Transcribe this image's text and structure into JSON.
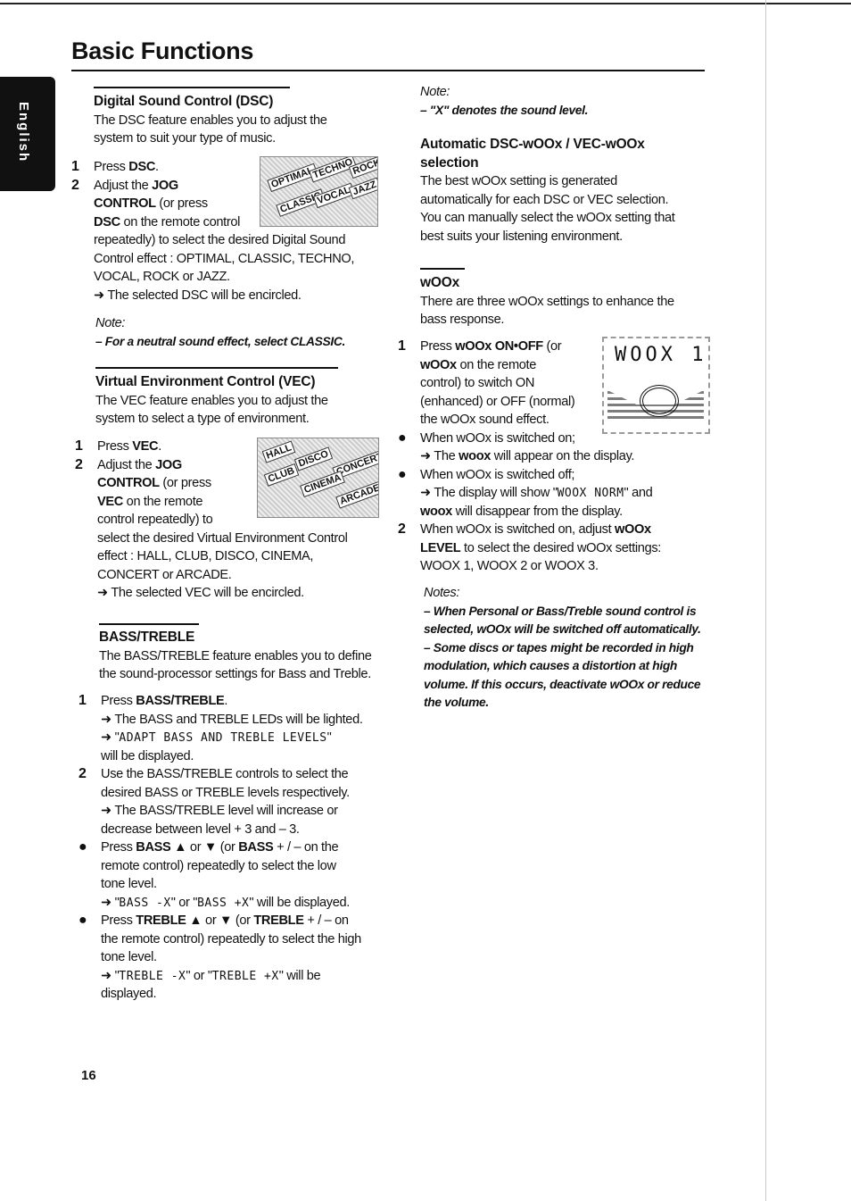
{
  "header": {
    "title": "Basic Functions",
    "language_tab": "English",
    "page_number": "16"
  },
  "images": {
    "dsc_display": [
      "OPTIMAL",
      "TECHNO",
      "ROCK",
      "CLASSIC",
      "VOCAL",
      "JAZZ"
    ],
    "vec_display": [
      "HALL",
      "DISCO",
      "CONCERT",
      "CLUB",
      "CINEMA",
      "ARCADE"
    ],
    "woox_display": "WOOX 1"
  },
  "left": [
    {
      "lines": [
        {
          "h": 1,
          "s": [
            [
              "Digital Sound Control (DSC)",
              0
            ]
          ]
        },
        {
          "s": [
            [
              "The DSC feature enables you to adjust the",
              0
            ]
          ]
        },
        {
          "s": [
            [
              "system to suit your type of music.",
              0
            ]
          ]
        }
      ]
    },
    {
      "lines": [
        {
          "m": "1",
          "s": [
            [
              "Press ",
              0
            ],
            [
              "DSC",
              1
            ],
            [
              ".",
              0
            ]
          ]
        },
        {
          "m": "2",
          "s": [
            [
              "Adjust the ",
              0
            ],
            [
              "JOG",
              1
            ]
          ]
        },
        {
          "s": [
            [
              "CONTROL",
              1
            ],
            [
              " (or press",
              0
            ]
          ]
        },
        {
          "s": [
            [
              "DSC",
              1
            ],
            [
              " on the remote control",
              0
            ]
          ]
        },
        {
          "s": [
            [
              "repeatedly) to select the desired Digital Sound",
              0
            ]
          ]
        },
        {
          "s": [
            [
              "Control effect : OPTIMAL, CLASSIC, TECHNO,",
              0
            ]
          ]
        },
        {
          "s": [
            [
              "VOCAL, ROCK or JAZZ.",
              0
            ]
          ]
        },
        {
          "s": [
            [
              "➜ The selected DSC will be encircled.",
              0
            ]
          ]
        }
      ]
    },
    {
      "lines": [
        {
          "s": [
            [
              "Note:",
              2
            ]
          ]
        },
        {
          "s": [
            [
              "– For a neutral sound effect, select CLASSIC.",
              4
            ]
          ]
        }
      ]
    },
    {
      "lines": [
        {
          "h": 1,
          "s": [
            [
              "Virtual Environment Control (VEC)",
              0
            ]
          ]
        },
        {
          "s": [
            [
              "The VEC feature enables you to adjust the",
              0
            ]
          ]
        },
        {
          "s": [
            [
              "system to select a type of environment.",
              0
            ]
          ]
        }
      ]
    },
    {
      "lines": [
        {
          "m": "1",
          "s": [
            [
              "Press ",
              0
            ],
            [
              "VEC",
              1
            ],
            [
              ".",
              0
            ]
          ]
        },
        {
          "m": "2",
          "s": [
            [
              "Adjust the ",
              0
            ],
            [
              "JOG",
              1
            ]
          ]
        },
        {
          "s": [
            [
              "CONTROL",
              1
            ],
            [
              " (or press",
              0
            ]
          ]
        },
        {
          "s": [
            [
              "VEC",
              1
            ],
            [
              " on the remote",
              0
            ]
          ]
        },
        {
          "s": [
            [
              "control repeatedly) to",
              0
            ]
          ]
        },
        {
          "s": [
            [
              "select the desired Virtual Environment Control",
              0
            ]
          ]
        },
        {
          "s": [
            [
              "effect : HALL, CLUB, DISCO, CINEMA,",
              0
            ]
          ]
        },
        {
          "s": [
            [
              "CONCERT or ARCADE.",
              0
            ]
          ]
        },
        {
          "s": [
            [
              "➜ The selected VEC will be encircled.",
              0
            ]
          ]
        }
      ]
    },
    {
      "lines": [
        {
          "h": 1,
          "s": [
            [
              "BASS/TREBLE",
              0
            ]
          ]
        },
        {
          "s": [
            [
              "The BASS/TREBLE feature enables you to define",
              0
            ]
          ]
        },
        {
          "s": [
            [
              "the sound-processor settings for Bass and Treble.",
              0
            ]
          ]
        }
      ]
    },
    {
      "lines": [
        {
          "m": "1",
          "s": [
            [
              "Press ",
              0
            ],
            [
              "BASS/TREBLE",
              1
            ],
            [
              ".",
              0
            ]
          ]
        },
        {
          "s": [
            [
              "➜ The BASS and TREBLE LEDs will be lighted.",
              0
            ]
          ]
        },
        {
          "s": [
            [
              "➜ \"",
              0
            ],
            [
              "ADAPT BASS AND TREBLE LEVELS",
              3
            ],
            [
              "\"",
              0
            ]
          ]
        },
        {
          "s": [
            [
              "will be displayed.",
              0
            ]
          ]
        },
        {
          "m": "2",
          "s": [
            [
              "Use the  BASS/TREBLE controls to select the",
              0
            ]
          ]
        },
        {
          "s": [
            [
              "desired BASS or TREBLE levels respectively.",
              0
            ]
          ]
        },
        {
          "s": [
            [
              "➜ The BASS/TREBLE level will increase or",
              0
            ]
          ]
        },
        {
          "s": [
            [
              "decrease between level + 3 and – 3.",
              0
            ]
          ]
        },
        {
          "m": "●",
          "s": [
            [
              "Press ",
              0
            ],
            [
              "BASS",
              1
            ],
            [
              " ▲ or ▼ (or ",
              0
            ],
            [
              "BASS",
              1
            ],
            [
              " + / – on the",
              0
            ]
          ]
        },
        {
          "s": [
            [
              "remote control) repeatedly to select the low",
              0
            ]
          ]
        },
        {
          "s": [
            [
              "tone level.",
              0
            ]
          ]
        },
        {
          "s": [
            [
              "➜ \"",
              0
            ],
            [
              "BASS -X",
              3
            ],
            [
              "\" or \"",
              0
            ],
            [
              "BASS +X",
              3
            ],
            [
              "\"  will be displayed.",
              0
            ]
          ]
        },
        {
          "m": "●",
          "s": [
            [
              "Press ",
              0
            ],
            [
              "TREBLE",
              1
            ],
            [
              " ▲ or ▼ (or ",
              0
            ],
            [
              "TREBLE",
              1
            ],
            [
              " + / – on",
              0
            ]
          ]
        },
        {
          "s": [
            [
              "the remote control) repeatedly to select the high",
              0
            ]
          ]
        },
        {
          "s": [
            [
              "tone level.",
              0
            ]
          ]
        },
        {
          "s": [
            [
              "➜ \"",
              0
            ],
            [
              "TREBLE -X",
              3
            ],
            [
              "\" or \"",
              0
            ],
            [
              "TREBLE +X",
              3
            ],
            [
              "\"  will be",
              0
            ]
          ]
        },
        {
          "s": [
            [
              "displayed.",
              0
            ]
          ]
        }
      ]
    }
  ],
  "right": [
    {
      "lines": [
        {
          "s": [
            [
              "Note:",
              2
            ]
          ]
        },
        {
          "s": [
            [
              "– \"X\" denotes the sound level.",
              4
            ]
          ]
        }
      ]
    },
    {
      "lines": [
        {
          "h": 1,
          "s": [
            [
              "Automatic DSC-wOOx / VEC-wOOx",
              0
            ]
          ]
        },
        {
          "h": 1,
          "s": [
            [
              "selection",
              0
            ]
          ]
        },
        {
          "s": [
            [
              "The best wOOx setting is generated",
              0
            ]
          ]
        },
        {
          "s": [
            [
              "automatically for each DSC or VEC selection.",
              0
            ]
          ]
        },
        {
          "s": [
            [
              "You can manually select the wOOx setting that",
              0
            ]
          ]
        },
        {
          "s": [
            [
              "best suits your listening environment.",
              0
            ]
          ]
        }
      ]
    },
    {
      "lines": [
        {
          "h": 1,
          "s": [
            [
              "wOOx",
              0
            ]
          ]
        },
        {
          "s": [
            [
              "There are three wOOx settings to enhance the",
              0
            ]
          ]
        },
        {
          "s": [
            [
              "bass response.",
              0
            ]
          ]
        }
      ]
    },
    {
      "lines": [
        {
          "m": "1",
          "s": [
            [
              "Press ",
              0
            ],
            [
              "wOOx ON•OFF",
              1
            ],
            [
              " (or",
              0
            ]
          ]
        },
        {
          "s": [
            [
              "wOOx",
              1
            ],
            [
              " on the remote",
              0
            ]
          ]
        },
        {
          "s": [
            [
              "control) to switch ON",
              0
            ]
          ]
        },
        {
          "s": [
            [
              "(enhanced) or OFF (normal)",
              0
            ]
          ]
        },
        {
          "s": [
            [
              "the wOOx sound effect.",
              0
            ]
          ]
        },
        {
          "m": "●",
          "s": [
            [
              "When wOOx is switched on;",
              0
            ]
          ]
        },
        {
          "s": [
            [
              "➜ The ",
              0
            ],
            [
              "woox",
              1
            ],
            [
              " will appear on the display.",
              0
            ]
          ]
        },
        {
          "m": "●",
          "s": [
            [
              "When wOOx is switched off;",
              0
            ]
          ]
        },
        {
          "s": [
            [
              "➜ The display will show \"",
              0
            ],
            [
              "WOOX NORM",
              3
            ],
            [
              "\" and",
              0
            ]
          ]
        },
        {
          "s": [
            [
              "woox",
              1
            ],
            [
              " will disappear from the display.",
              0
            ]
          ]
        },
        {
          "m": "2",
          "s": [
            [
              "When wOOx is switched on, adjust ",
              0
            ],
            [
              "wOOx",
              1
            ]
          ]
        },
        {
          "s": [
            [
              "LEVEL",
              1
            ],
            [
              " to select the desired wOOx settings:",
              0
            ]
          ]
        },
        {
          "s": [
            [
              "WOOX 1, WOOX 2 or WOOX 3.",
              0
            ]
          ]
        }
      ]
    },
    {
      "lines": [
        {
          "s": [
            [
              "Notes:",
              2
            ]
          ]
        },
        {
          "s": [
            [
              "– When Personal or Bass/Treble sound control is",
              4
            ]
          ]
        },
        {
          "s": [
            [
              "selected, wOOx will be switched off automatically.",
              4
            ]
          ]
        },
        {
          "s": [
            [
              "– Some discs or tapes might be recorded in high",
              4
            ]
          ]
        },
        {
          "s": [
            [
              "modulation, which causes a distortion at high",
              4
            ]
          ]
        },
        {
          "s": [
            [
              "volume. If this occurs, deactivate wOOx or reduce",
              4
            ]
          ]
        },
        {
          "s": [
            [
              "the volume.",
              4
            ]
          ]
        }
      ]
    }
  ]
}
